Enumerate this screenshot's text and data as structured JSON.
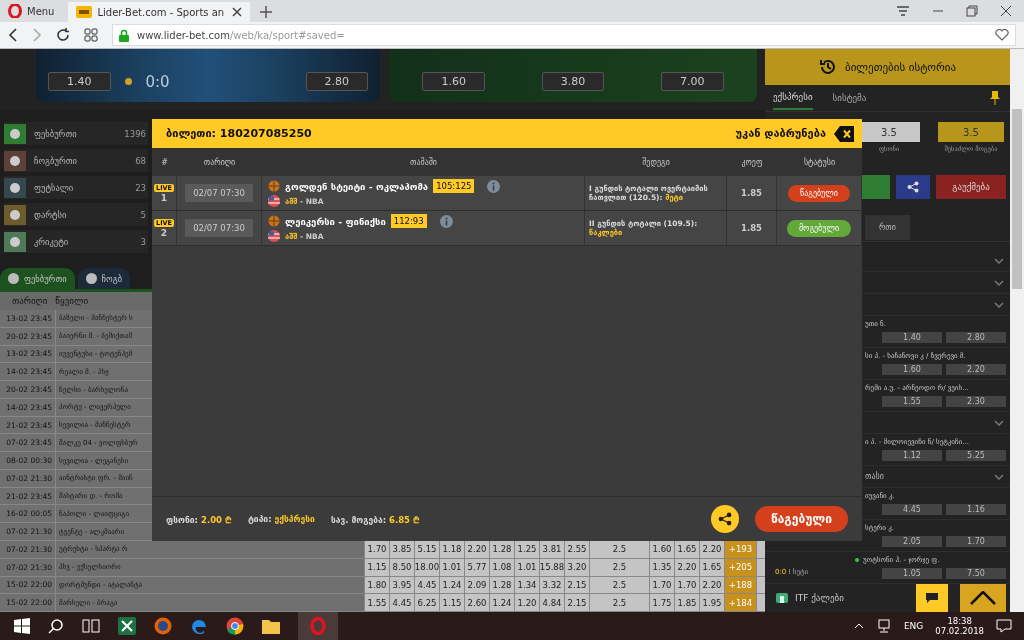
{
  "browser": {
    "menu": "Menu",
    "tabs": [
      {
        "title": "Lider-Bet.com - Sports an",
        "selected": true
      }
    ],
    "url_host": "www.lider-bet.com",
    "url_path": "/web/ka/sport#saved="
  },
  "banner": {
    "cards": [
      {
        "kind": "tennis",
        "odds": [
          "1.40",
          "2.80"
        ],
        "score": "0:0"
      },
      {
        "kind": "football",
        "odds": [
          "1.60",
          "3.80",
          "7.00"
        ]
      }
    ]
  },
  "sports": [
    {
      "name": "ფეხბურთი",
      "count": "1396",
      "color": "#2e7d32"
    },
    {
      "name": "ჩოგბურთი",
      "count": "68",
      "color": "#5d4037"
    },
    {
      "name": "ფუტსალი",
      "count": "23",
      "color": "#37474f"
    },
    {
      "name": "დარტსი",
      "count": "5",
      "color": "#6d5d2e"
    },
    {
      "name": "კრიკეტი",
      "count": "3",
      "color": "#4e7a57"
    }
  ],
  "sport_tabs": [
    {
      "label": "ფეხბურთი",
      "selected": true
    },
    {
      "label": "ჩოგბ",
      "selected": false
    }
  ],
  "table": {
    "columns": [
      "თარიღი",
      "წყვილი"
    ],
    "rows": [
      {
        "date": "13-02 23:45",
        "match": "ბაზელი - მანჩესტერ ს"
      },
      {
        "date": "20-02 23:45",
        "match": "ბაიერნი მ. - ბეშიქთაშ"
      },
      {
        "date": "13-02 23:45",
        "match": "იუვენტუსი - ტოტენჰემ"
      },
      {
        "date": "14-02 23:45",
        "match": "რეალი მ. - პსჟ"
      },
      {
        "date": "20-02 23:45",
        "match": "ჩელსი - ბარსელონა"
      },
      {
        "date": "14-02 23:45",
        "match": "პორტუ - ლივერპული"
      },
      {
        "date": "21-02 23:45",
        "match": "სევილია - მანჩესტერ"
      },
      {
        "date": "07-02 23:45",
        "match": "შალკე 04 - ვოლფსბურ"
      },
      {
        "date": "08-02 00:30",
        "match": "სევილია - ლეგანესი"
      },
      {
        "date": "07-02 21:30",
        "match": "აინტრახტი ფრ. - მაინ"
      },
      {
        "date": "21-02 23:45",
        "match": "შახტარი დ. - რომა"
      },
      {
        "date": "16-02 00:05",
        "match": "ნაპოლი - ლაიფციგი"
      },
      {
        "date": "07-02 21:30",
        "match": "ტვენტე - ალკმაარი"
      },
      {
        "date": "07-02 21:30",
        "match": "უტრეხტი - სპარტა რ",
        "odds": [
          "1.70",
          "3.85",
          "5.15",
          "1.18",
          "2.20",
          "1.28",
          "1.25",
          "3.81",
          "2.55",
          "2.5",
          "1.60",
          "1.65",
          "2.20"
        ],
        "more": "+193"
      },
      {
        "date": "07-02 21:30",
        "match": "პსვ - ექსელსიორი",
        "odds": [
          "1.15",
          "8.50",
          "18.00",
          "1.01",
          "5.77",
          "1.08",
          "1.01",
          "15.88",
          "3.20",
          "2.5",
          "1.35",
          "2.20",
          "1.65"
        ],
        "more": "+205"
      },
      {
        "date": "15-02 22:00",
        "match": "დორტმუნდი - ატალანტა",
        "odds": [
          "1.80",
          "3.95",
          "4.45",
          "1.24",
          "2.09",
          "1.28",
          "1.34",
          "3.32",
          "2.15",
          "2.5",
          "1.70",
          "1.70",
          "2.20"
        ],
        "more": "+188"
      },
      {
        "date": "15-02 22:00",
        "match": "მარსელი - ბრაგა",
        "odds": [
          "1.55",
          "4.45",
          "6.25",
          "1.15",
          "2.60",
          "1.24",
          "1.20",
          "4.84",
          "2.15",
          "2.5",
          "1.75",
          "1.85",
          "1.95"
        ],
        "more": "+184"
      }
    ]
  },
  "ticket_panel": {
    "title": "ბილეთების ისტორია",
    "tabs": [
      {
        "label": "ექსპრესი",
        "selected": true
      },
      {
        "label": "სისტემა",
        "selected": false
      }
    ],
    "values": [
      {
        "value": "3.5",
        "label": "ფსონი",
        "kind": "stake"
      },
      {
        "value": "3.5",
        "label": "შესაძლო მოგება",
        "kind": "win"
      }
    ],
    "cancel": "გაუქმება",
    "subtab": "რთი",
    "list": [
      {
        "kind": "header"
      },
      {
        "kind": "header"
      },
      {
        "kind": "header"
      },
      {
        "kind": "match",
        "name": "უთი ნ.",
        "odds": [
          "1.40",
          "2.80"
        ]
      },
      {
        "kind": "match",
        "name": "სი პ. - ხაჩანოვი კ / ზვერევი მ.",
        "odds": [
          "1.60",
          "2.20"
        ]
      },
      {
        "kind": "match",
        "name": "რემი ა.უ. - არნეოდო რ/ ვეის...",
        "odds": [
          "1.55",
          "2.30"
        ]
      },
      {
        "kind": "header"
      },
      {
        "kind": "match",
        "name": "ი პ. - მილოიევიჩი ნ/ სეტკიჩი...",
        "odds": [
          "1.12",
          "5.25"
        ]
      },
      {
        "kind": "header",
        "name": "თასი"
      },
      {
        "kind": "match",
        "name": "იუვანი კ.",
        "odds": [
          "4.45",
          "1.16"
        ]
      },
      {
        "kind": "match",
        "name": "სტერი კ.",
        "odds": [
          "2.05",
          "1.70"
        ]
      },
      {
        "kind": "match",
        "name": "უოტსონი ჰ. - ჯორჯე ფ.",
        "live": true,
        "score": "0:0",
        "set": "I სეტი",
        "odds": [
          "1.05",
          "7.50"
        ]
      },
      {
        "kind": "league",
        "name": "ITF ქალები"
      }
    ]
  },
  "modal": {
    "title": "ბილეთი: 180207085250",
    "back": "უკან დაბრუნება",
    "columns": [
      "#",
      "თარიღი",
      "თამაში",
      "შედეგი",
      "კოეფ",
      "სტატუსი"
    ],
    "rows": [
      {
        "live": true,
        "live_label": "LIVE",
        "number": "1",
        "date": "02/07 07:30",
        "game": "გოლდენ სტეიტი - ოკლაჰომა",
        "score": "105:125",
        "country": "აშშ",
        "league": "- NBA",
        "outcome": "I გუნდის ტოტალი ოვერტაიმის ჩათვლით (120.5):",
        "pick": "მეტი",
        "odds": "1.85",
        "status": "წაგებული",
        "won": false
      },
      {
        "live": true,
        "live_label": "LIVE",
        "number": "2",
        "date": "02/07 07:30",
        "game": "ლეიკერსი - ფინიქსი",
        "score": "112:93",
        "country": "აშშ",
        "league": "- NBA",
        "outcome": "II გუნდის ტოტალი (109.5):",
        "pick": "ნაკლები",
        "odds": "1.85",
        "status": "მოგებული",
        "won": true
      }
    ],
    "summary": [
      {
        "label": "ფსონი:",
        "value": "2.00 ₾"
      },
      {
        "label": "ტიპი:",
        "value": "ექსპრესი"
      },
      {
        "label": "სავ. მოგება:",
        "value": "6.85 ₾"
      }
    ],
    "result": "წაგებული",
    "won": false
  },
  "taskbar": {
    "language": "ENG",
    "time": "18:38",
    "date": "07.02.2018"
  }
}
